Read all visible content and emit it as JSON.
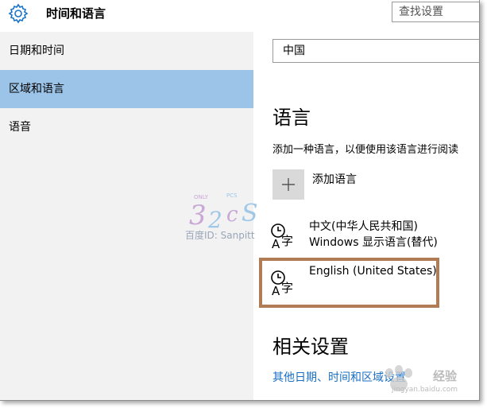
{
  "header": {
    "title": "时间和语言",
    "search_placeholder": "查找设置"
  },
  "sidebar": {
    "items": [
      {
        "label": "日期和时间"
      },
      {
        "label": "区域和语言"
      },
      {
        "label": "语音"
      }
    ],
    "selected_index": 1
  },
  "main": {
    "country_value": "中国",
    "language_section": {
      "title": "语言",
      "description": "添加一种语言，以便使用该语言进行阅读",
      "add_label": "添加语言",
      "languages": [
        {
          "name": "中文(中华人民共和国)",
          "sub": "Windows 显示语言(替代)"
        },
        {
          "name": "English (United States)"
        }
      ]
    },
    "related": {
      "title": "相关设置",
      "link": "其他日期、时间和区域设置"
    }
  },
  "watermarks": {
    "baidu_id": "百度ID: Sanpitt",
    "site_label": "经验",
    "site_url": "jingyan.baidu.com"
  },
  "colors": {
    "selected_nav": "#9cc4e8",
    "sidebar_bg": "#f2f2f2",
    "link": "#1a6fc4",
    "gear": "#1a73c7",
    "highlight_box": "#b07b55"
  }
}
